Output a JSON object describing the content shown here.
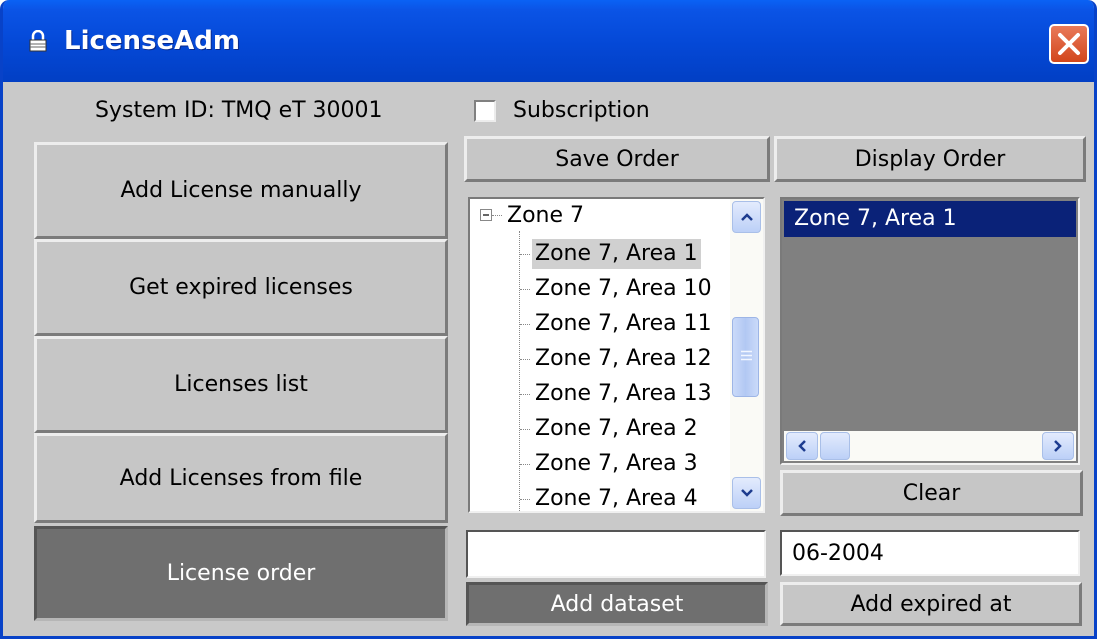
{
  "window": {
    "title": "LicenseAdm",
    "title_icon": "lock-icon",
    "close_icon": "close-icon"
  },
  "system_id": "System ID: TMQ eT 30001",
  "subscription": {
    "label": "Subscription",
    "checked": false
  },
  "left_buttons": [
    {
      "label": "Add License manually",
      "active": false
    },
    {
      "label": "Get expired licenses",
      "active": false
    },
    {
      "label": "Licenses list",
      "active": false
    },
    {
      "label": "Add Licenses from file",
      "active": false
    },
    {
      "label": "License order",
      "active": true
    }
  ],
  "save_order_label": "Save Order",
  "display_order_label": "Display Order",
  "tree": {
    "root": "Zone 7",
    "children": [
      "Zone 7, Area 1",
      "Zone 7, Area 10",
      "Zone 7, Area 11",
      "Zone 7, Area 12",
      "Zone 7, Area 13",
      "Zone 7, Area 2",
      "Zone 7, Area 3",
      "Zone 7, Area 4"
    ],
    "selected_index": 0
  },
  "order_list": {
    "items": [
      "Zone 7, Area 1"
    ]
  },
  "clear_label": "Clear",
  "dataset_input": {
    "value": ""
  },
  "expired_input": {
    "value": "06-2004"
  },
  "add_dataset_label": "Add dataset",
  "add_expired_label": "Add expired at"
}
